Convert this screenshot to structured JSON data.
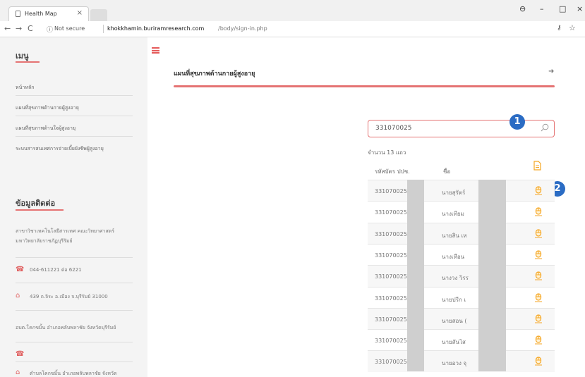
{
  "browser": {
    "tab_title": "Health Map",
    "tab_close": "×",
    "security_label": "Not secure",
    "url_host": "khokkhamin.buriramresearch.com",
    "url_path": "/body/sign-in.php",
    "nav_back": "←",
    "nav_forward": "→",
    "nav_reload": "C",
    "security_icon": "ⓘ",
    "win_account": "⊖",
    "win_minimize": "–",
    "win_maximize": "□",
    "win_close": "×",
    "key_icon": "⚷",
    "star_icon": "☆"
  },
  "sidebar": {
    "menu_title": "เมนู",
    "items": [
      {
        "label": "หน้าหลัก"
      },
      {
        "label": "แผนที่สุขภาพด้านกายผู้สูงอายุ"
      },
      {
        "label": "แผนที่สุขภาพด้านใจผู้สูงอายุ"
      },
      {
        "label": "ระบบสารสนเทศการจ่ายเบี้ยยังชีพผู้สูงอายุ"
      }
    ],
    "contact_title": "ข้อมูลติดต่อ",
    "contact": {
      "org_line1": "สาขาวิชาเทคโนโลยีสารเทศ คณะวิทยาศาสตร์",
      "org_line2": "มหาวิทยาลัยราชภัฏบุรีรัมย์",
      "phone": "044-611221 ต่อ 6221",
      "address": "439 ถ.จิระ อ.เมือง จ.บุรีรัมย์ 31000",
      "org2": "อบต.โคกขมิ้น อำเภอพลับพลาชัย จังหวัดบุรีรัมย์",
      "address2": "ตำบลโคกขมิ้น อำเภอพลับพลาชัย จังหวัด"
    }
  },
  "main": {
    "title": "แผนที่สุขภาพด้านกายผู้สูงอายุ",
    "search_value": "331070025",
    "callout1": "1",
    "callout2": "2",
    "count_text": "จำนวน 13 แถว",
    "table": {
      "col_id": "รหัสบัตร ปปช.",
      "col_name": "ชื่อ",
      "rows": [
        {
          "id": "331070025",
          "name": "นายสุรัตร์"
        },
        {
          "id": "331070025",
          "name": "นางเทียม"
        },
        {
          "id": "331070025",
          "name": "นายสิน เห"
        },
        {
          "id": "331070025",
          "name": "นางเหือน"
        },
        {
          "id": "331070025",
          "name": "นางวง วิรร"
        },
        {
          "id": "331070025",
          "name": "นายปรีก เ"
        },
        {
          "id": "331070025",
          "name": "นายสอน ("
        },
        {
          "id": "331070025",
          "name": "นายสันไส"
        },
        {
          "id": "331070025",
          "name": "นายอวง จุ"
        }
      ]
    }
  },
  "colors": {
    "accent": "#e57373",
    "callout": "#2b6cc4",
    "icon_orange": "#f5a623",
    "sidebar_bg": "#f4f4f4"
  }
}
